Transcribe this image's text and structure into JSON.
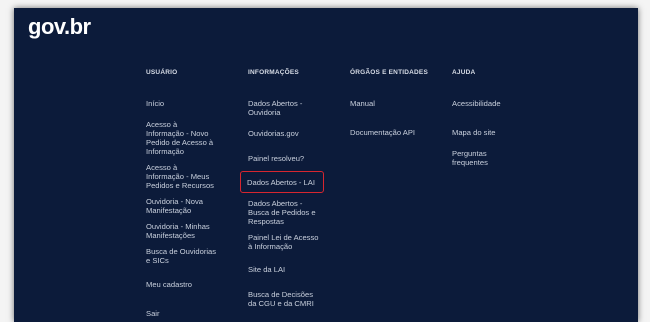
{
  "brand": {
    "logo_text": "gov.br"
  },
  "footer": {
    "columns": [
      {
        "heading": "USUÁRIO",
        "links": [
          "Início",
          "Acesso à\nInformação - Novo\nPedido de Acesso à\nInformação",
          "Acesso à\nInformação - Meus\nPedidos e Recursos",
          "Ouvidoria - Nova\nManifestação",
          "Ouvidoria - Minhas\nManifestações",
          "Busca de Ouvidorias\ne SICs",
          "Meu cadastro",
          "Sair"
        ]
      },
      {
        "heading": "INFORMAÇÕES",
        "links": [
          "Dados Abertos -\nOuvidoria",
          "Ouvidorias.gov",
          "Painel resolveu?",
          "Dados Abertos - LAI",
          "Dados Abertos -\nBusca de Pedidos e\nRespostas",
          "Painel Lei de Acesso\nà Informação",
          "Site da LAI",
          "Busca de Decisões\nda CGU e da CMRI"
        ]
      },
      {
        "heading": "ÓRGÃOS E ENTIDADES",
        "links": [
          "Manual",
          "Documentação API"
        ]
      },
      {
        "heading": "AJUDA",
        "links": [
          "Acessibilidade",
          "Mapa do site",
          "Perguntas\nfrequentes"
        ]
      }
    ]
  },
  "colors": {
    "footer_background": "#0c1b3a",
    "highlight_border": "#d7262f",
    "link_text": "#c9d0dd"
  }
}
